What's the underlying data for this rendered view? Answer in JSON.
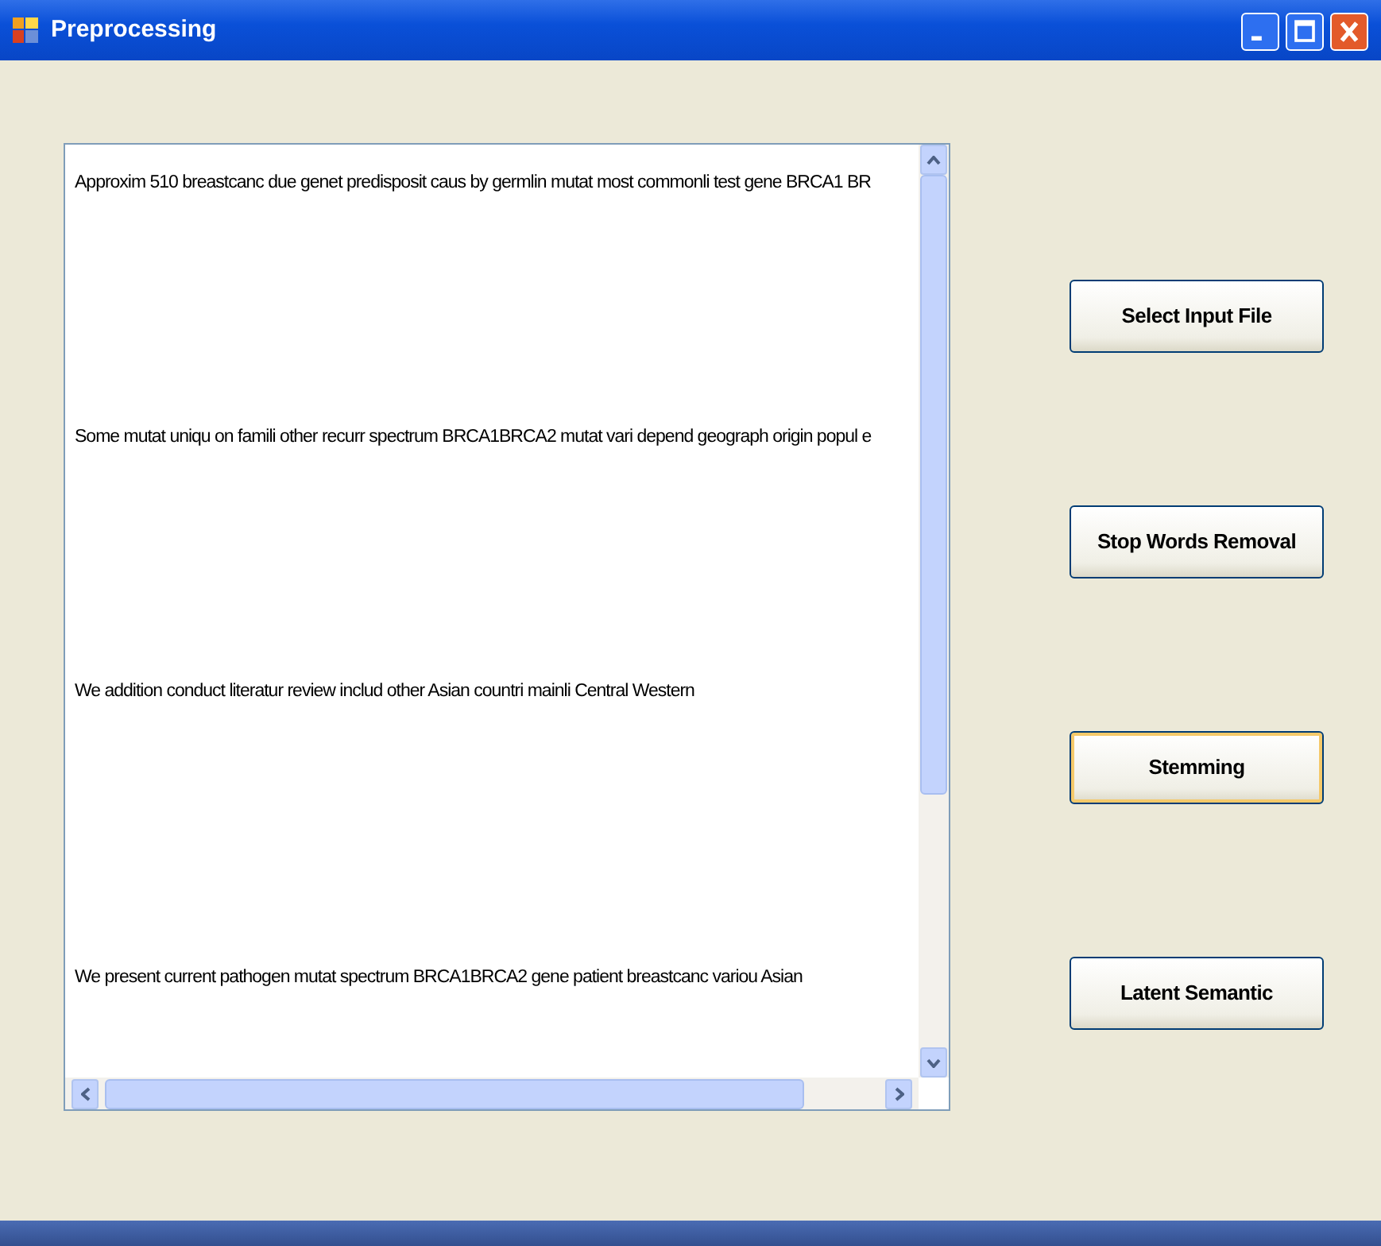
{
  "window": {
    "title": "Preprocessing"
  },
  "text_box": {
    "lines": [
      "Approxim 510 breastcanc due genet predisposit caus by germlin mutat most commonli test gene BRCA1 BR",
      "Some mutat uniqu on famili other recurr spectrum BRCA1BRCA2 mutat vari depend geograph origin popul e",
      "We addition conduct literatur review includ other Asian countri mainli Central Western",
      "We present current pathogen mutat spectrum BRCA1BRCA2 gene patient breastcanc variou Asian"
    ]
  },
  "buttons": [
    {
      "label": "Select Input File",
      "focused": false
    },
    {
      "label": "Stop Words Removal",
      "focused": false
    },
    {
      "label": "Stemming",
      "focused": true
    },
    {
      "label": "Latent Semantic",
      "focused": false
    }
  ]
}
